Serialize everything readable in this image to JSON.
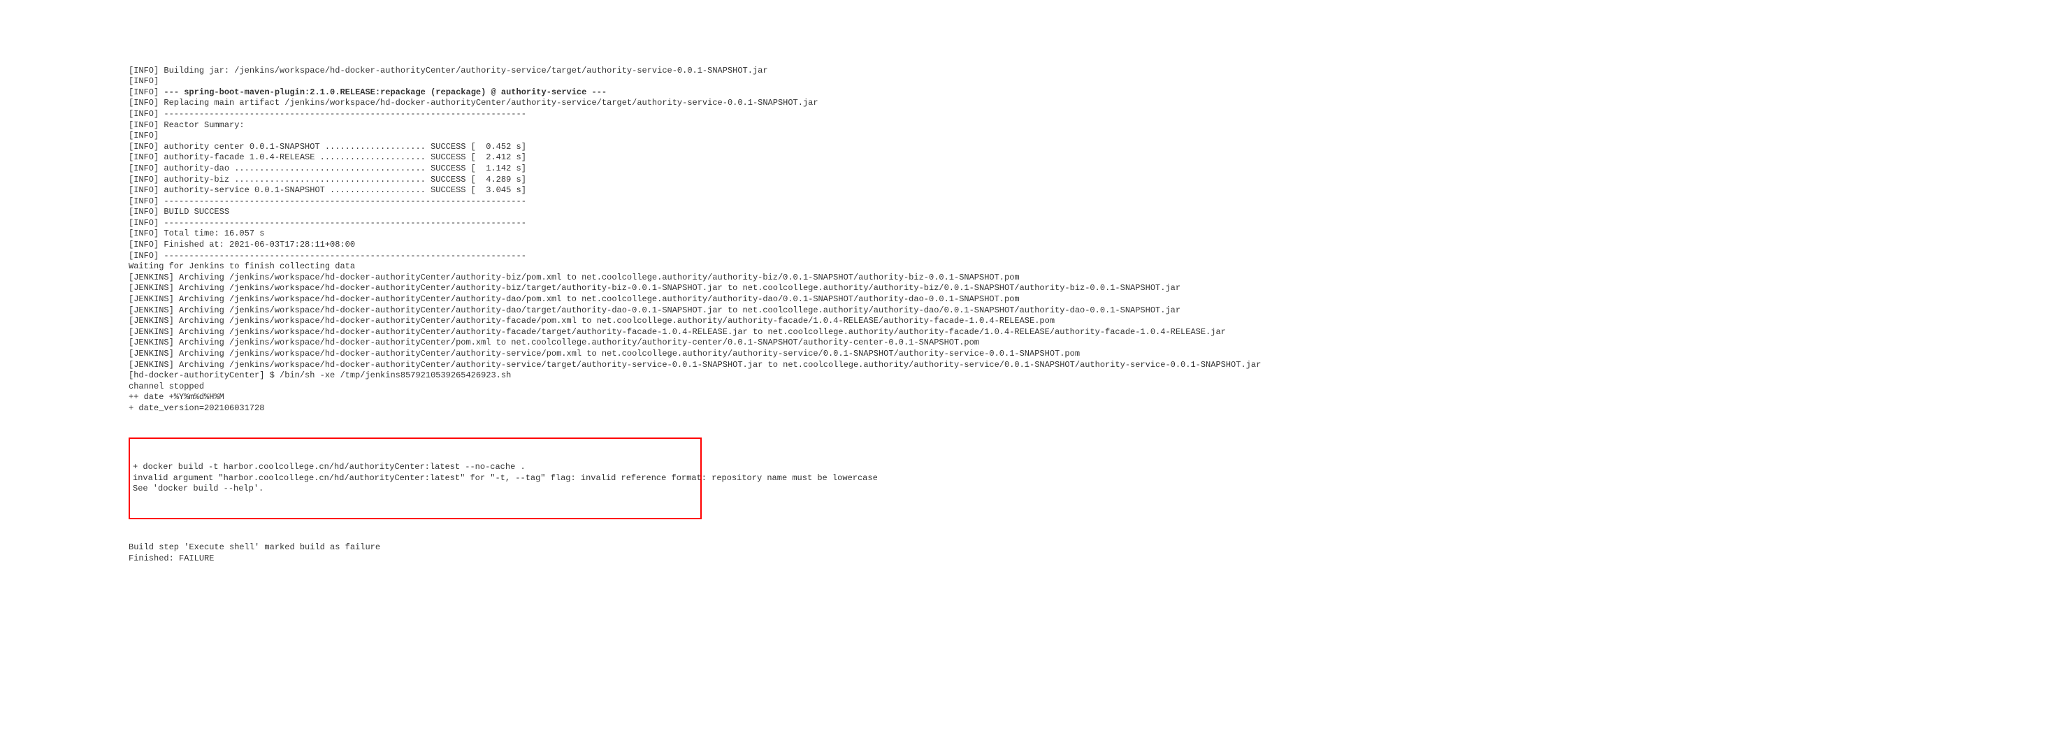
{
  "lines": [
    {
      "text": "[INFO] Building jar: /jenkins/workspace/hd-docker-authorityCenter/authority-service/target/authority-service-0.0.1-SNAPSHOT.jar"
    },
    {
      "text": "[INFO] "
    },
    {
      "prefix": "[INFO] ",
      "bold": "--- spring-boot-maven-plugin:2.1.0.RELEASE:repackage (repackage) @ authority-service ---"
    },
    {
      "text": "[INFO] Replacing main artifact /jenkins/workspace/hd-docker-authorityCenter/authority-service/target/authority-service-0.0.1-SNAPSHOT.jar"
    },
    {
      "text": "[INFO] ------------------------------------------------------------------------"
    },
    {
      "text": "[INFO] Reactor Summary:"
    },
    {
      "text": "[INFO] "
    },
    {
      "text": "[INFO] authority center 0.0.1-SNAPSHOT .................... SUCCESS [  0.452 s]"
    },
    {
      "text": "[INFO] authority-facade 1.0.4-RELEASE ..................... SUCCESS [  2.412 s]"
    },
    {
      "text": "[INFO] authority-dao ...................................... SUCCESS [  1.142 s]"
    },
    {
      "text": "[INFO] authority-biz ...................................... SUCCESS [  4.289 s]"
    },
    {
      "text": "[INFO] authority-service 0.0.1-SNAPSHOT ................... SUCCESS [  3.045 s]"
    },
    {
      "text": "[INFO] ------------------------------------------------------------------------"
    },
    {
      "text": "[INFO] BUILD SUCCESS"
    },
    {
      "text": "[INFO] ------------------------------------------------------------------------"
    },
    {
      "text": "[INFO] Total time: 16.057 s"
    },
    {
      "text": "[INFO] Finished at: 2021-06-03T17:28:11+08:00"
    },
    {
      "text": "[INFO] ------------------------------------------------------------------------"
    },
    {
      "text": "Waiting for Jenkins to finish collecting data"
    },
    {
      "text": "[JENKINS] Archiving /jenkins/workspace/hd-docker-authorityCenter/authority-biz/pom.xml to net.coolcollege.authority/authority-biz/0.0.1-SNAPSHOT/authority-biz-0.0.1-SNAPSHOT.pom"
    },
    {
      "text": "[JENKINS] Archiving /jenkins/workspace/hd-docker-authorityCenter/authority-biz/target/authority-biz-0.0.1-SNAPSHOT.jar to net.coolcollege.authority/authority-biz/0.0.1-SNAPSHOT/authority-biz-0.0.1-SNAPSHOT.jar"
    },
    {
      "text": "[JENKINS] Archiving /jenkins/workspace/hd-docker-authorityCenter/authority-dao/pom.xml to net.coolcollege.authority/authority-dao/0.0.1-SNAPSHOT/authority-dao-0.0.1-SNAPSHOT.pom"
    },
    {
      "text": "[JENKINS] Archiving /jenkins/workspace/hd-docker-authorityCenter/authority-dao/target/authority-dao-0.0.1-SNAPSHOT.jar to net.coolcollege.authority/authority-dao/0.0.1-SNAPSHOT/authority-dao-0.0.1-SNAPSHOT.jar"
    },
    {
      "text": "[JENKINS] Archiving /jenkins/workspace/hd-docker-authorityCenter/authority-facade/pom.xml to net.coolcollege.authority/authority-facade/1.0.4-RELEASE/authority-facade-1.0.4-RELEASE.pom"
    },
    {
      "text": "[JENKINS] Archiving /jenkins/workspace/hd-docker-authorityCenter/authority-facade/target/authority-facade-1.0.4-RELEASE.jar to net.coolcollege.authority/authority-facade/1.0.4-RELEASE/authority-facade-1.0.4-RELEASE.jar"
    },
    {
      "text": "[JENKINS] Archiving /jenkins/workspace/hd-docker-authorityCenter/pom.xml to net.coolcollege.authority/authority-center/0.0.1-SNAPSHOT/authority-center-0.0.1-SNAPSHOT.pom"
    },
    {
      "text": "[JENKINS] Archiving /jenkins/workspace/hd-docker-authorityCenter/authority-service/pom.xml to net.coolcollege.authority/authority-service/0.0.1-SNAPSHOT/authority-service-0.0.1-SNAPSHOT.pom"
    },
    {
      "text": "[JENKINS] Archiving /jenkins/workspace/hd-docker-authorityCenter/authority-service/target/authority-service-0.0.1-SNAPSHOT.jar to net.coolcollege.authority/authority-service/0.0.1-SNAPSHOT/authority-service-0.0.1-SNAPSHOT.jar"
    },
    {
      "text": "[hd-docker-authorityCenter] $ /bin/sh -xe /tmp/jenkins8579210539265426923.sh"
    },
    {
      "text": "channel stopped"
    },
    {
      "text": "++ date +%Y%m%d%H%M"
    },
    {
      "text": "+ date_version=202106031728"
    }
  ],
  "error_box": [
    "+ docker build -t harbor.coolcollege.cn/hd/authorityCenter:latest --no-cache .",
    "invalid argument \"harbor.coolcollege.cn/hd/authorityCenter:latest\" for \"-t, --tag\" flag: invalid reference format: repository name must be lowercase",
    "See 'docker build --help'."
  ],
  "footer_lines": [
    "Build step 'Execute shell' marked build as failure",
    "Finished: FAILURE"
  ]
}
